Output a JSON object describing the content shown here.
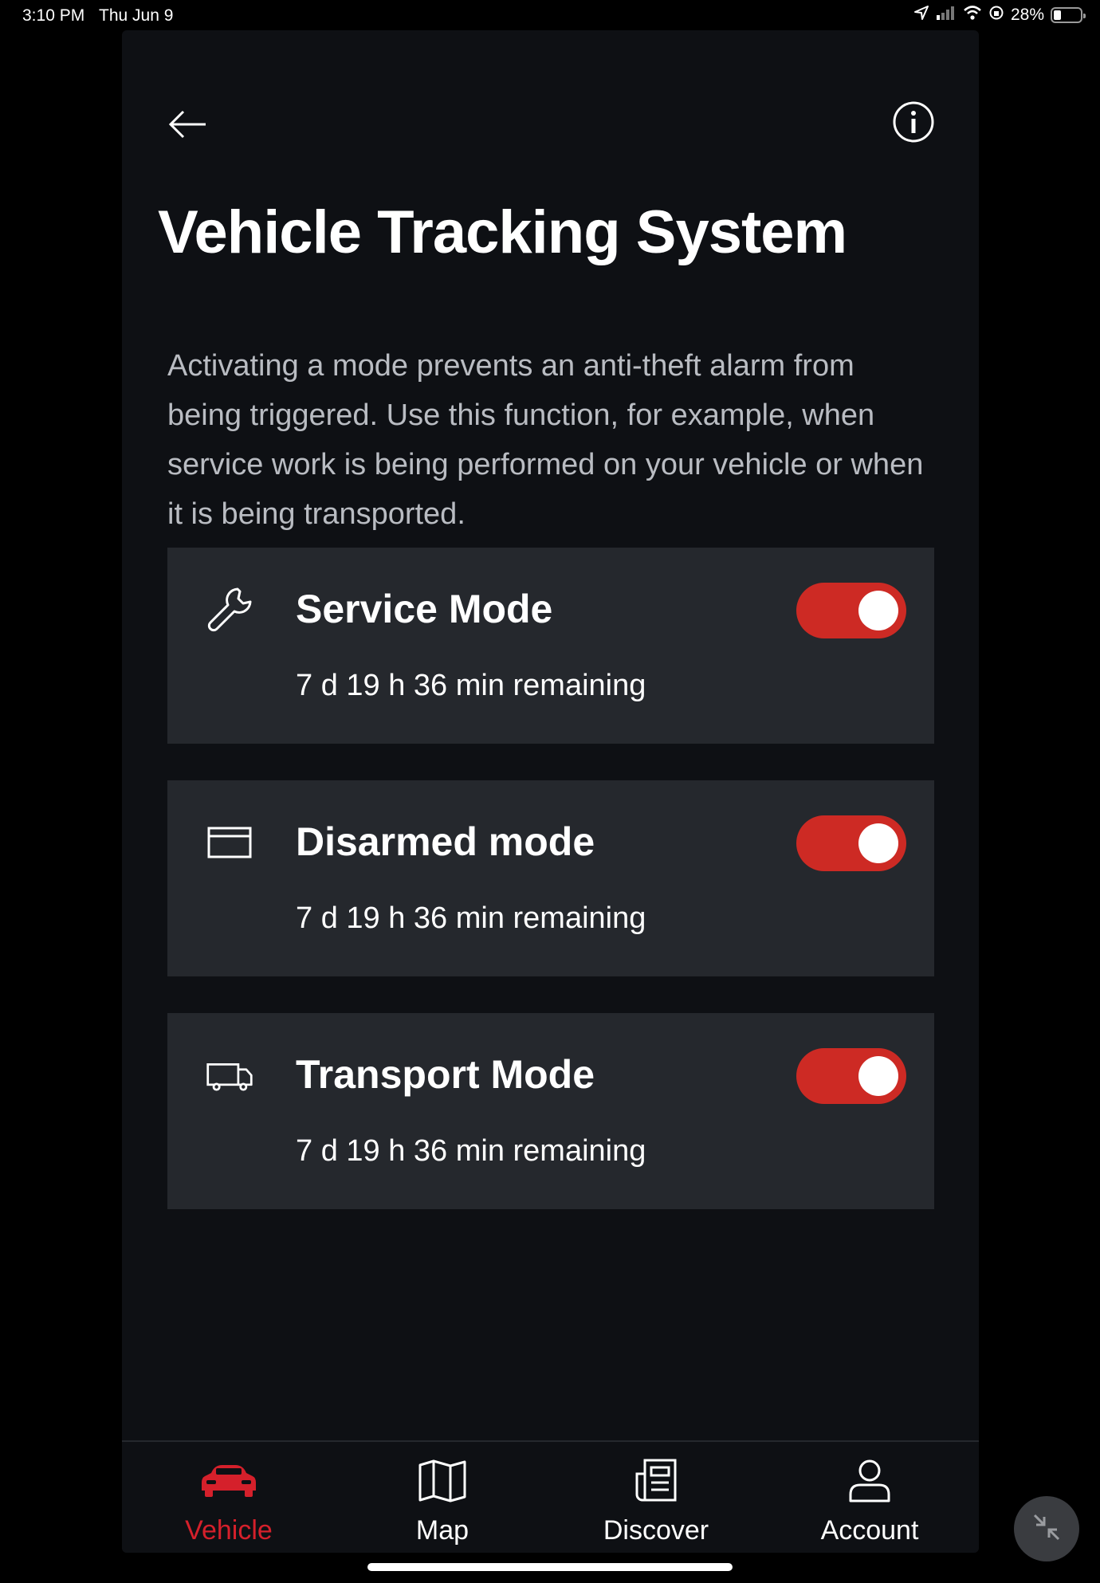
{
  "status_bar": {
    "time": "3:10 PM",
    "date": "Thu Jun 9",
    "battery": "28%",
    "battery_level": 0.28,
    "icons": [
      "location-icon",
      "signal-icon",
      "wifi-icon",
      "rotation-lock-icon",
      "battery-icon"
    ]
  },
  "header": {
    "back_icon": "arrow-left-icon",
    "info_icon": "info-icon"
  },
  "page": {
    "title": "Vehicle Tracking System",
    "description": "Activating a mode prevents an anti-theft alarm from being triggered. Use this function, for example, when service work is being performed on your vehicle or when it is being transported."
  },
  "modes": [
    {
      "icon": "wrench-icon",
      "title": "Service Mode",
      "remaining": "7 d 19 h 36 min remaining",
      "enabled": true
    },
    {
      "icon": "card-icon",
      "title": "Disarmed mode",
      "remaining": "7 d 19 h 36 min remaining",
      "enabled": true
    },
    {
      "icon": "truck-icon",
      "title": "Transport Mode",
      "remaining": "7 d 19 h 36 min remaining",
      "enabled": true
    }
  ],
  "tabs": [
    {
      "label": "Vehicle",
      "icon": "car-icon",
      "active": true
    },
    {
      "label": "Map",
      "icon": "map-icon",
      "active": false
    },
    {
      "label": "Discover",
      "icon": "newspaper-icon",
      "active": false
    },
    {
      "label": "Account",
      "icon": "user-icon",
      "active": false
    }
  ],
  "colors": {
    "accent": "#d5202b",
    "toggle_on": "#cd2a24",
    "background": "#0e1014",
    "card": "#25282d"
  }
}
